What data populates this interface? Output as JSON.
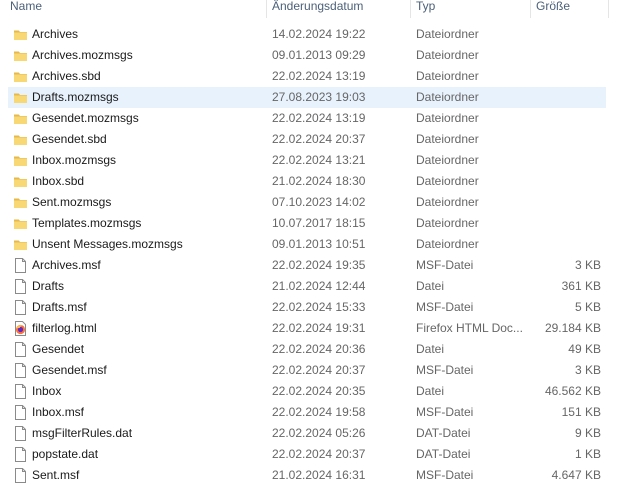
{
  "columns": {
    "name": "Name",
    "date": "Änderungsdatum",
    "type": "Typ",
    "size": "Größe"
  },
  "files": [
    {
      "name": "Archives",
      "date": "14.02.2024 19:22",
      "type": "Dateiordner",
      "size": "",
      "icon": "folder-icon"
    },
    {
      "name": "Archives.mozmsgs",
      "date": "09.01.2013 09:29",
      "type": "Dateiordner",
      "size": "",
      "icon": "folder-icon"
    },
    {
      "name": "Archives.sbd",
      "date": "22.02.2024 13:19",
      "type": "Dateiordner",
      "size": "",
      "icon": "folder-icon"
    },
    {
      "name": "Drafts.mozmsgs",
      "date": "27.08.2023 19:03",
      "type": "Dateiordner",
      "size": "",
      "icon": "folder-icon",
      "selected": true
    },
    {
      "name": "Gesendet.mozmsgs",
      "date": "22.02.2024 13:19",
      "type": "Dateiordner",
      "size": "",
      "icon": "folder-icon"
    },
    {
      "name": "Gesendet.sbd",
      "date": "22.02.2024 20:37",
      "type": "Dateiordner",
      "size": "",
      "icon": "folder-icon"
    },
    {
      "name": "Inbox.mozmsgs",
      "date": "22.02.2024 13:21",
      "type": "Dateiordner",
      "size": "",
      "icon": "folder-icon"
    },
    {
      "name": "Inbox.sbd",
      "date": "21.02.2024 18:30",
      "type": "Dateiordner",
      "size": "",
      "icon": "folder-icon"
    },
    {
      "name": "Sent.mozmsgs",
      "date": "07.10.2023 14:02",
      "type": "Dateiordner",
      "size": "",
      "icon": "folder-icon"
    },
    {
      "name": "Templates.mozmsgs",
      "date": "10.07.2017 18:15",
      "type": "Dateiordner",
      "size": "",
      "icon": "folder-icon"
    },
    {
      "name": "Unsent Messages.mozmsgs",
      "date": "09.01.2013 10:51",
      "type": "Dateiordner",
      "size": "",
      "icon": "folder-icon"
    },
    {
      "name": "Archives.msf",
      "date": "22.02.2024 19:35",
      "type": "MSF-Datei",
      "size": "3 KB",
      "icon": "file-icon"
    },
    {
      "name": "Drafts",
      "date": "21.02.2024 12:44",
      "type": "Datei",
      "size": "361 KB",
      "icon": "file-icon"
    },
    {
      "name": "Drafts.msf",
      "date": "22.02.2024 15:33",
      "type": "MSF-Datei",
      "size": "5 KB",
      "icon": "file-icon"
    },
    {
      "name": "filterlog.html",
      "date": "22.02.2024 19:31",
      "type": "Firefox HTML Doc...",
      "size": "29.184 KB",
      "icon": "firefox-html-icon"
    },
    {
      "name": "Gesendet",
      "date": "22.02.2024 20:36",
      "type": "Datei",
      "size": "49 KB",
      "icon": "file-icon"
    },
    {
      "name": "Gesendet.msf",
      "date": "22.02.2024 20:37",
      "type": "MSF-Datei",
      "size": "3 KB",
      "icon": "file-icon"
    },
    {
      "name": "Inbox",
      "date": "22.02.2024 20:35",
      "type": "Datei",
      "size": "46.562 KB",
      "icon": "file-icon"
    },
    {
      "name": "Inbox.msf",
      "date": "22.02.2024 19:58",
      "type": "MSF-Datei",
      "size": "151 KB",
      "icon": "file-icon"
    },
    {
      "name": "msgFilterRules.dat",
      "date": "22.02.2024 05:26",
      "type": "DAT-Datei",
      "size": "9 KB",
      "icon": "file-icon"
    },
    {
      "name": "popstate.dat",
      "date": "22.02.2024 20:37",
      "type": "DAT-Datei",
      "size": "1 KB",
      "icon": "file-icon"
    },
    {
      "name": "Sent.msf",
      "date": "21.02.2024 16:31",
      "type": "MSF-Datei",
      "size": "4.647 KB",
      "icon": "file-icon"
    }
  ],
  "colors": {
    "folder": "#f8d775",
    "folder_dark": "#e7b84a",
    "selection": "#e8f2fc",
    "header_text": "#4c607a"
  }
}
